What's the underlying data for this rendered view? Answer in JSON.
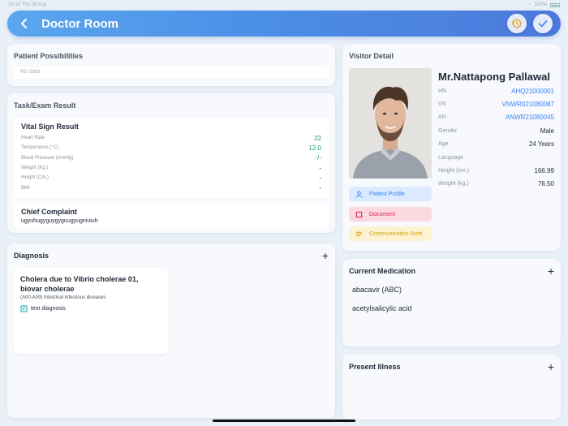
{
  "status": {
    "time": "10:15",
    "date": "Thu 26 Aug",
    "battery": "100%"
  },
  "header": {
    "title": "Doctor Room"
  },
  "possibilities": {
    "title": "Patient Possibilities",
    "empty": "No data"
  },
  "task": {
    "title": "Task/Exam Result",
    "vital_title": "Vital Sign Result",
    "vitals": [
      {
        "label": "Heart Rate",
        "value": "22"
      },
      {
        "label": "Temperature (°C)",
        "value": "12.0"
      },
      {
        "label": "Blood Pressure (mmHg)",
        "value": "-/-"
      },
      {
        "label": "Weight (Kg.)",
        "value": "-"
      },
      {
        "label": "Height (Cm.)",
        "value": "-"
      },
      {
        "label": "BMI",
        "value": "-"
      }
    ],
    "complaint_title": "Chief Complaint",
    "complaint_text": "ugyuhugyguygyguugyugniuiuh"
  },
  "diagnosis": {
    "title": "Diagnosis",
    "item": {
      "name": "Cholera due to Vibrio cholerae 01, biovar cholerae",
      "code": "(A00-A09) Intestinal infectious diseases",
      "note": "test diagnosis"
    }
  },
  "visitor": {
    "title": "Visitor Detail",
    "name": "Mr.Nattapong Pallawal",
    "fields": [
      {
        "label": "HN",
        "value": "AHQ21000001"
      },
      {
        "label": "VN",
        "value": "VNWR021080087"
      },
      {
        "label": "AN",
        "value": "ANWR21080045"
      },
      {
        "label": "Gender",
        "value": "Male"
      },
      {
        "label": "Age",
        "value": "24 Years"
      },
      {
        "label": "Language",
        "value": ""
      },
      {
        "label": "Height (cm.)",
        "value": "166.99"
      },
      {
        "label": "Weight (kg.)",
        "value": "76.50"
      }
    ],
    "buttons": {
      "profile": "Patient Profile",
      "document": "Document",
      "note": "Communication Note"
    }
  },
  "medication": {
    "title": "Current Medication",
    "items": [
      "abacavir (ABC)",
      "acetylsalicylic acid"
    ]
  },
  "illness": {
    "title": "Present Illness"
  },
  "colors": {
    "header_start": "#5aa6ee",
    "header_end": "#4c79dc",
    "link": "#3b82f6",
    "positive": "#22a06b"
  }
}
